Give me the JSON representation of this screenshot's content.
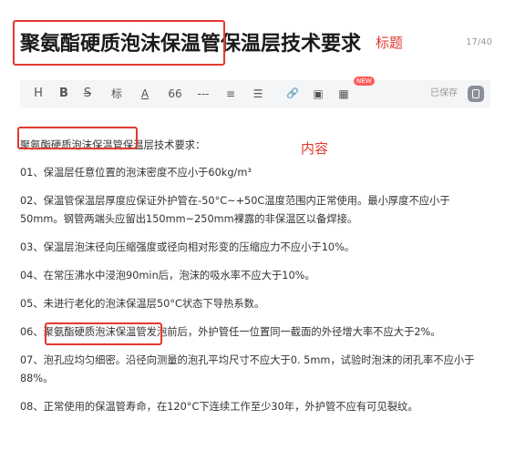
{
  "title": "聚氨酯硬质泡沫保温管保温层技术要求",
  "annotations": {
    "title_label": "标题",
    "content_label": "内容"
  },
  "counter": "17/40",
  "toolbar": {
    "heading": "H",
    "bold": "B",
    "strike": "S",
    "tag": "标",
    "font_color": "A",
    "quote": "66",
    "divider": "---",
    "ordered_list": "≡",
    "unordered_list": "☰",
    "link": "🔗",
    "image": "▣",
    "table": "▦",
    "new_badge": "NEW",
    "saved": "已保存"
  },
  "content": {
    "intro": "聚氨酯硬质泡沫保温管保温层技术要求：",
    "items": [
      "01、保温层任意位置的泡沫密度不应小于60kg/m³",
      "02、保温管保温层厚度应保证外护管在-50°C~+50C温度范围内正常使用。最小厚度不应小于50mm。钢管两端头应留出150mm~250mm裸露的非保温区以备焊接。",
      "03、保温层泡沫径向压缩强度或径向相对形变的压缩应力不应小于10%。",
      "04、在常压沸水中浸泡90min后，泡沫的吸水率不应大于10%。",
      "05、未进行老化的泡沫保温层50°C状态下导热系数。",
      "06、聚氨酯硬质泡沫保温管发泡前后，外护管任一位置同一截面的外径增大率不应大于2%。",
      "07、泡孔应均匀细密。沿径向测量的泡孔平均尺寸不应大于0. 5mm，试验时泡沫的闭孔率不应小于88%。",
      "08、正常使用的保温管寿命，在120°C下连续工作至少30年，外护管不应有可见裂纹。"
    ]
  },
  "colors": {
    "highlight": "#e23a2e",
    "toolbar_bg": "#f4f5f7"
  }
}
